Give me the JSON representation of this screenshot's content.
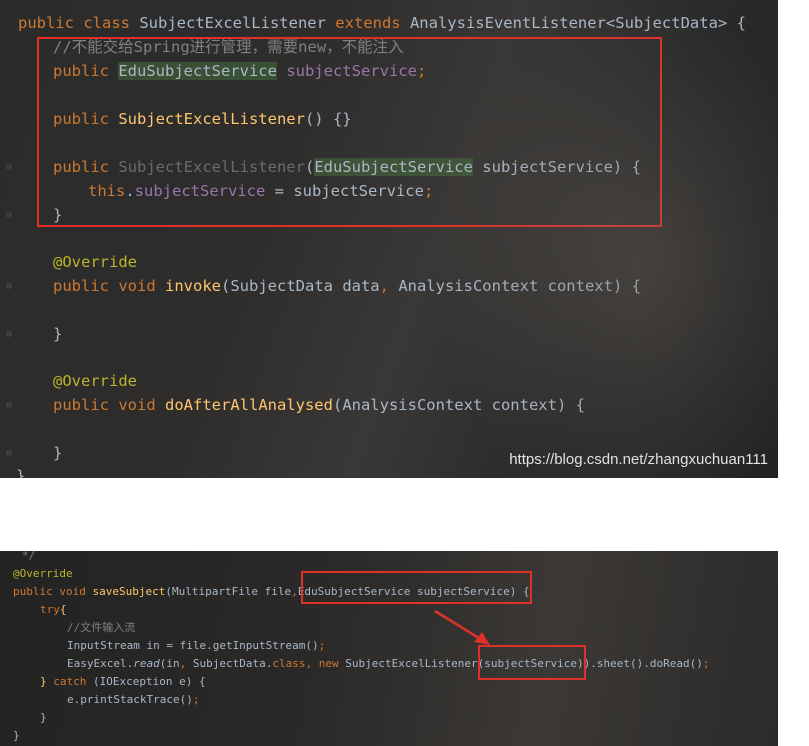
{
  "panel1": {
    "lines": [
      {
        "parts": [
          {
            "t": "public ",
            "c": "kw"
          },
          {
            "t": "class ",
            "c": "kw"
          },
          {
            "t": "SubjectExcelListener ",
            "c": ""
          },
          {
            "t": "extends ",
            "c": "kw"
          },
          {
            "t": "AnalysisEventListener<SubjectData> {",
            "c": ""
          }
        ]
      },
      {
        "parts": [
          {
            "t": "//不能交给Spring进行管理，需要new，不能注入",
            "c": "cmt"
          }
        ]
      },
      {
        "parts": [
          {
            "t": "public ",
            "c": "kw"
          },
          {
            "t": "EduSubjectService",
            "c": "hl"
          },
          {
            "t": " ",
            "c": ""
          },
          {
            "t": "subjectService",
            "c": "fld"
          },
          {
            "t": ";",
            "c": "kw"
          }
        ]
      },
      {
        "parts": [
          {
            "t": "public ",
            "c": "kw"
          },
          {
            "t": "SubjectExcelListener",
            "c": "mth"
          },
          {
            "t": "() {}",
            "c": ""
          }
        ]
      },
      {
        "parts": [
          {
            "t": "public ",
            "c": "kw"
          },
          {
            "t": "SubjectExcelListener",
            "c": "dim"
          },
          {
            "t": "(",
            "c": ""
          },
          {
            "t": "EduSubjectService",
            "c": "hl"
          },
          {
            "t": " subjectService) {",
            "c": ""
          }
        ]
      },
      {
        "parts": [
          {
            "t": "this",
            "c": "kw"
          },
          {
            "t": ".",
            "c": ""
          },
          {
            "t": "subjectService",
            "c": "fld"
          },
          {
            "t": " = subjectService",
            "c": ""
          },
          {
            "t": ";",
            "c": "kw"
          }
        ]
      },
      {
        "parts": [
          {
            "t": "}",
            "c": ""
          }
        ]
      },
      {
        "parts": [
          {
            "t": "@Override",
            "c": "ann"
          }
        ]
      },
      {
        "parts": [
          {
            "t": "public ",
            "c": "kw"
          },
          {
            "t": "void ",
            "c": "kw"
          },
          {
            "t": "invoke",
            "c": "mth"
          },
          {
            "t": "(SubjectData data",
            "c": ""
          },
          {
            "t": ", ",
            "c": "kw"
          },
          {
            "t": "AnalysisContext context) {",
            "c": ""
          }
        ]
      },
      {
        "parts": [
          {
            "t": "}",
            "c": ""
          }
        ]
      },
      {
        "parts": [
          {
            "t": "@Override",
            "c": "ann"
          }
        ]
      },
      {
        "parts": [
          {
            "t": "public ",
            "c": "kw"
          },
          {
            "t": "void ",
            "c": "kw"
          },
          {
            "t": "doAfterAllAnalysed",
            "c": "mth"
          },
          {
            "t": "(AnalysisContext context) {",
            "c": ""
          }
        ]
      },
      {
        "parts": [
          {
            "t": "}",
            "c": ""
          }
        ]
      },
      {
        "parts": [
          {
            "t": "}",
            "c": ""
          }
        ]
      }
    ],
    "watermark": "https://blog.csdn.net/zhangxuchuan111"
  },
  "panel2": {
    "lines": [
      {
        "parts": [
          {
            "t": "*/",
            "c": "cmt"
          }
        ]
      },
      {
        "parts": [
          {
            "t": "@Override",
            "c": "ann"
          }
        ]
      },
      {
        "parts": [
          {
            "t": "public ",
            "c": "kw"
          },
          {
            "t": "void ",
            "c": "kw"
          },
          {
            "t": "saveSubject",
            "c": "mth"
          },
          {
            "t": "(MultipartFile file",
            "c": ""
          },
          {
            "t": ",",
            "c": "kw"
          },
          {
            "t": "EduSubjectService subjectService) {",
            "c": ""
          }
        ]
      },
      {
        "parts": [
          {
            "t": "try",
            "c": "kw"
          },
          {
            "t": "{",
            "c": "mth"
          }
        ]
      },
      {
        "parts": [
          {
            "t": "//文件输入流",
            "c": "cmt"
          }
        ]
      },
      {
        "parts": [
          {
            "t": "InputStream in = file.getInputStream()",
            "c": ""
          },
          {
            "t": ";",
            "c": "kw"
          }
        ]
      },
      {
        "parts": [
          {
            "t": "EasyExcel.",
            "c": ""
          },
          {
            "t": "read",
            "c": "ital"
          },
          {
            "t": "(in",
            "c": ""
          },
          {
            "t": ", ",
            "c": "kw"
          },
          {
            "t": "SubjectData.",
            "c": ""
          },
          {
            "t": "class",
            "c": "kw"
          },
          {
            "t": ", ",
            "c": "kw"
          },
          {
            "t": "new ",
            "c": "kw"
          },
          {
            "t": "SubjectExcelListener(subjectService)).sheet().doRead()",
            "c": ""
          },
          {
            "t": ";",
            "c": "kw"
          }
        ]
      },
      {
        "parts": [
          {
            "t": "} ",
            "c": "mth"
          },
          {
            "t": "catch ",
            "c": "kw"
          },
          {
            "t": "(IOException e) {",
            "c": ""
          }
        ]
      },
      {
        "parts": [
          {
            "t": "e.printStackTrace()",
            "c": ""
          },
          {
            "t": ";",
            "c": "kw"
          }
        ]
      },
      {
        "parts": [
          {
            "t": "}",
            "c": ""
          }
        ]
      },
      {
        "parts": [
          {
            "t": "}",
            "c": ""
          }
        ]
      }
    ]
  },
  "colors": {
    "box": "#e0302a",
    "background": "#2b2b2b",
    "keyword": "#cc7832",
    "field": "#9876aa",
    "method": "#ffc66d",
    "annotation": "#bbb529",
    "comment": "#808080"
  }
}
